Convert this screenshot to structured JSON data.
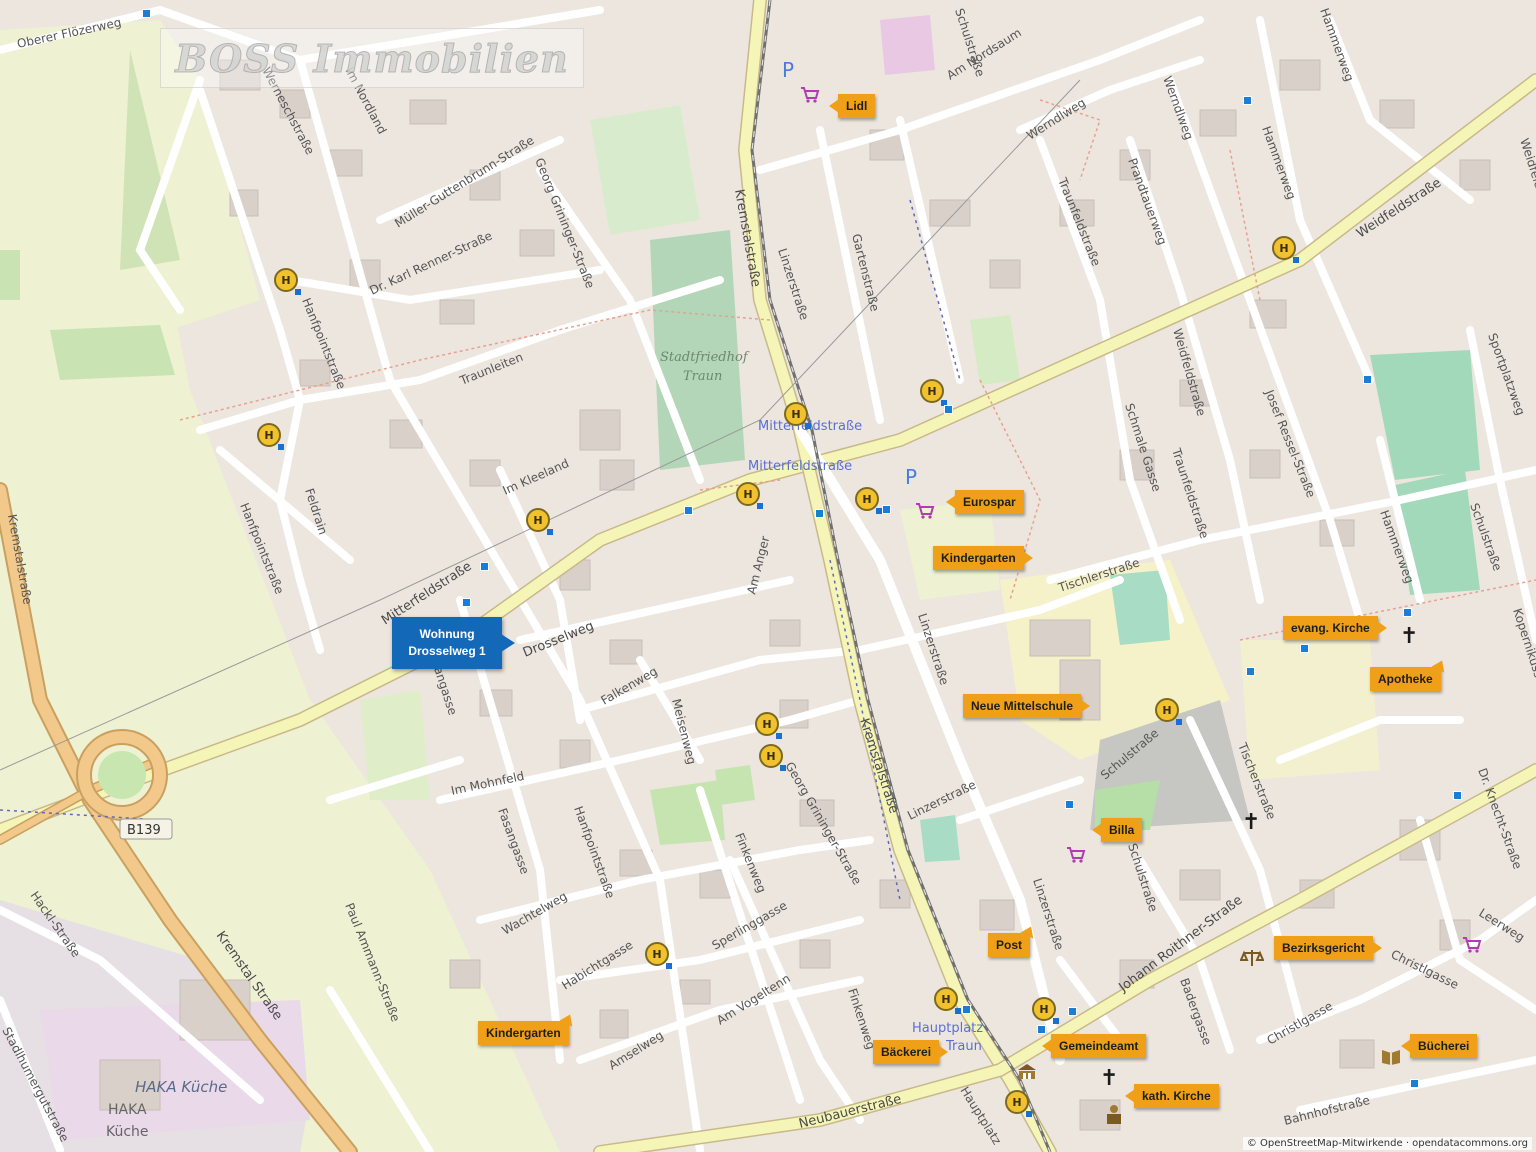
{
  "watermark": "BOSS Immobilien",
  "attribution": "© OpenStreetMap-Mitwirkende · opendatacommons.org",
  "home": {
    "line1": "Wohnung",
    "line2": "Drosselweg 1"
  },
  "callouts": {
    "lidl": "Lidl",
    "eurospar": "Eurospar",
    "kindergarten_north": "Kindergarten",
    "evang_kirche": "evang. Kirche",
    "apotheke": "Apotheke",
    "neue_mittelschule": "Neue Mittelschule",
    "billa": "Billa",
    "post": "Post",
    "bezirksgericht": "Bezirksgericht",
    "kindergarten_south": "Kindergarten",
    "baeckerei": "Bäckerei",
    "gemeindeamt": "Gemeindeamt",
    "kath_kirche": "kath. Kirche",
    "buecherei": "Bücherei"
  },
  "bus_symbol": "H",
  "parking_symbol": "P",
  "places": {
    "stadtfriedhof_1": "Stadtfriedhof",
    "stadtfriedhof_2": "Traun",
    "mitterfeldstrasse_1": "Mitterfeldstraße",
    "mitterfeldstrasse_2": "Mitterfeldstraße",
    "hauptplatz_1": "Hauptplatz",
    "hauptplatz_2": "Traun",
    "haka_italic": "HAKA Küche",
    "haka_1": "HAKA",
    "haka_2": "Küche",
    "b139": "B139"
  },
  "streets": {
    "oberer_flozerweg": "Oberer Flözerweg",
    "im_nordland": "Im Nordland",
    "wernerschstrasse": "Werneschstraße",
    "mueller_guttenbrunn": "Müller-Guttenbrunn-Straße",
    "georg_grininger_n": "Georg Grininger-Straße",
    "dr_karl_renner": "Dr. Karl Renner-Straße",
    "hanfpointstrasse_n": "Hanfpointstraße",
    "traunleiten": "Traunleiten",
    "feldrain": "Feldrain",
    "hanfpointstrasse_w": "Hanfpointstraße",
    "im_kleeland": "Im Kleeland",
    "mitterfeldstrasse": "Mitterfeldstraße",
    "kremstalstrasse_n": "Kremstalstraße",
    "linzerstrasse_n": "Linzerstraße",
    "gartenstrasse": "Gartenstraße",
    "am_nordsaum": "Am Nordsaum",
    "werndlweg": "Werndlweg",
    "traunfeldstrasse_n": "Traunfeldstraße",
    "prandtauerweg": "Prandtauerweg",
    "werndlweg2": "Werndlweg",
    "hammerweg_n": "Hammerweg",
    "weidfeldstrasse": "Weidfeldstraße",
    "weidfeldstrasse2": "Weidfeldstraße",
    "josef_ressel": "Josef Ressel-Straße",
    "sportplatzweg": "Sportplatzweg",
    "hammerweg_s": "Hammerweg",
    "schulstrasse_e": "Schulstraße",
    "schmale_gasse": "Schmale Gasse",
    "traunfeldstrasse_s": "Traunfeldstraße",
    "tischlerstrasse": "Tischlerstraße",
    "am_anger": "Am Anger",
    "drosselweg": "Drosselweg",
    "falkenweg": "Falkenweg",
    "meisenweg": "Meisenweg",
    "linzerstrasse_m": "Linzerstraße",
    "kremstalstrasse_s": "Kremstalstraße",
    "im_mohnfeld": "Im Mohnfeld",
    "fasangasse": "Fasangasse",
    "fasangasse2": "Fasangasse",
    "hanfpointstrasse_s": "Hanfpointstraße",
    "georg_grininger_s": "Georg Grininger-Straße",
    "wachtelweg": "Wachtelweg",
    "finkenweg": "Finkenweg",
    "sperlinggasse": "Sperlinggasse",
    "habichtgasse": "Habichtgasse",
    "am_vogeltenn": "Am Vogeltenn",
    "amselweg": "Amselweg",
    "finkenweg2": "Finkenweg",
    "linzerstrasse_s": "Linzerstraße",
    "linzerstrasse_s2": "Linzerstraße",
    "schulstrasse_s": "Schulstraße",
    "schulstrasse_s2": "Schulstraße",
    "johann_roithner": "Johann Roithner-Straße",
    "badergasse": "Badergasse",
    "tischerstrasse": "Tischerstraße",
    "christlgasse": "Christlgasse",
    "christlgasse2": "Christlgasse",
    "leerweg": "Leerweg",
    "dr_knecht": "Dr. Knecht-Straße",
    "koppler": "Kopernikusstraße",
    "neubauerstrasse": "Neubauerstraße",
    "hauptplatz_st": "Hauptplatz",
    "bahnhofstrasse": "Bahnhofstraße",
    "kremstal_strasse": "Kremstal Straße",
    "paul_ammann": "Paul Ammann-Straße",
    "hackl_strasse": "Hackl-Straße",
    "stadlhumergut": "Stadlhumergutstraße",
    "kremstalstrasse_w": "Kremstalstraße",
    "weidfeld_s": "Weidfeldstraße",
    "schulstr_n": "Schulstraße",
    "hammerweg_t": "Hammerweg"
  },
  "colors": {
    "background": "#ece6df",
    "fields": "#eef1d2",
    "grass": "#c8e6b0",
    "cemetery": "#b4d6b8",
    "school": "#f5f1c9",
    "road_major": "#f5f5b8",
    "road_trunk": "#f2c98a",
    "callout": "#f0a018",
    "home": "#1468b8",
    "bus_stop": "#1a7ed6"
  }
}
